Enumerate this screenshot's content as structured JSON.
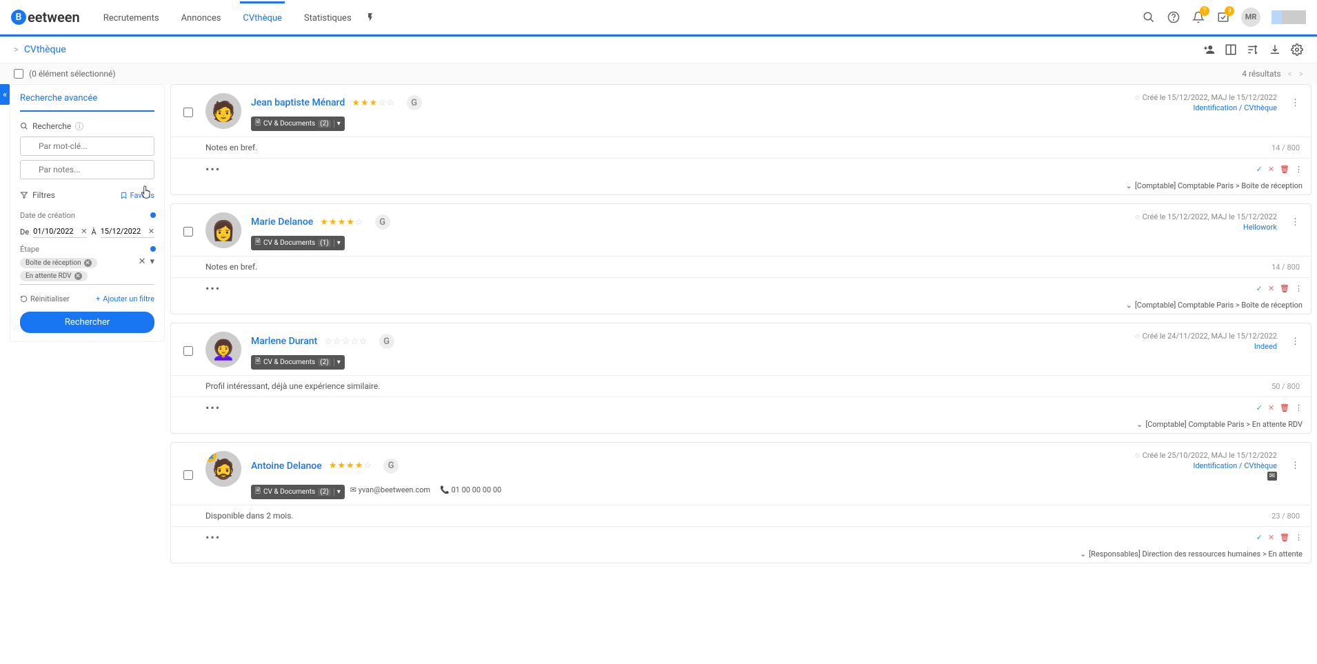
{
  "brand": "eetween",
  "nav": [
    "Recrutements",
    "Annonces",
    "CVthèque",
    "Statistiques"
  ],
  "nav_active": 2,
  "notif_badge": "7",
  "inbox_badge": "9",
  "user_initials": "MR",
  "breadcrumb": "CVthèque",
  "selection_text": "(0 élément sélectionné)",
  "results_count": "4 résultats",
  "sidebar": {
    "title": "Recherche avancée",
    "search_label": "Recherche",
    "keyword_placeholder": "Par mot-clé...",
    "notes_placeholder": "Par notes...",
    "filters_label": "Filtres",
    "favoris": "Favoris",
    "date_label": "Date de création",
    "date_from_label": "De",
    "date_to_label": "À",
    "date_from": "01/10/2022",
    "date_to": "15/12/2022",
    "stage_label": "Étape",
    "chips": [
      "Boîte de réception",
      "En attente RDV"
    ],
    "reset": "Réinitialiser",
    "add_filter": "Ajouter un filtre",
    "search_btn": "Rechercher"
  },
  "candidates": [
    {
      "name": "Jean baptiste Ménard",
      "stars": 3,
      "max_stars": 5,
      "docs_label": "CV & Documents",
      "docs_count": "(2)",
      "created": "Créé le 15/12/2022, MAJ le 15/12/2022",
      "source": "Identification / CVthèque",
      "notes": "Notes en bref.",
      "notes_count": "14 / 800",
      "path": "[Comptable] Comptable Paris > Boîte de réception",
      "avatar_emoji": "🧑"
    },
    {
      "name": "Marie Delanoe",
      "stars": 4,
      "max_stars": 5,
      "docs_label": "CV & Documents",
      "docs_count": "(1)",
      "created": "Créé le 15/12/2022, MAJ le 15/12/2022",
      "source": "Hellowork",
      "notes": "Notes en bref.",
      "notes_count": "14 / 800",
      "path": "[Comptable] Comptable Paris > Boîte de réception",
      "avatar_emoji": "👩"
    },
    {
      "name": "Marlene Durant",
      "stars": 0,
      "max_stars": 5,
      "docs_label": "CV & Documents",
      "docs_count": "(2)",
      "created": "Créé le 24/11/2022, MAJ le 15/12/2022",
      "source": "Indeed",
      "notes": "Profil intéressant, déjà une expérience similaire.",
      "notes_count": "50 / 800",
      "path": "[Comptable] Comptable Paris > En attente RDV",
      "avatar_emoji": "👩‍🦱"
    },
    {
      "name": "Antoine Delanoe",
      "stars": 4,
      "max_stars": 5,
      "docs_label": "CV & Documents",
      "docs_count": "(2)",
      "created": "Créé le 25/10/2022, MAJ le 15/12/2022",
      "source": "Identification / CVthèque",
      "email": "yvan@beetween.com",
      "phone": "01 00 00 00 00",
      "notes": "Disponible dans 2 mois.",
      "notes_count": "23 / 800",
      "path": "[Responsables] Direction des ressources humaines > En attente",
      "avatar_emoji": "🧔",
      "has_badge": true,
      "has_envelope": true
    }
  ]
}
